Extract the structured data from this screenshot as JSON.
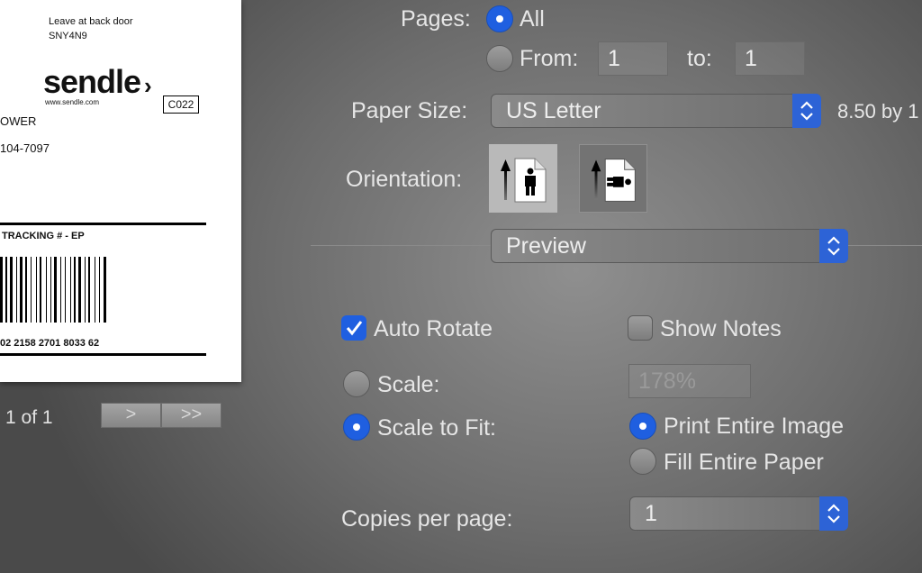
{
  "preview": {
    "delivery_note": "Leave at back door",
    "code": "SNY4N9",
    "logo_text": "sendle",
    "logo_url": "www.sendle.com",
    "box_code": "C022",
    "name_fragment": "OWER",
    "phone_fragment": "104-7097",
    "tracking_label": "TRACKING # - EP",
    "tracking_number": "02 2158 2701 8033 62",
    "page_indicator": "1 of 1",
    "next_label": ">",
    "last_label": ">>"
  },
  "pages": {
    "label": "Pages:",
    "all_label": "All",
    "from_label": "From:",
    "from_value": "1",
    "to_label": "to:",
    "to_value": "1"
  },
  "paper_size": {
    "label": "Paper Size:",
    "value": "US Letter",
    "dimensions": "8.50 by 1"
  },
  "orientation": {
    "label": "Orientation:"
  },
  "section_popup": {
    "value": "Preview"
  },
  "options": {
    "auto_rotate": "Auto Rotate",
    "show_notes": "Show Notes",
    "scale_label": "Scale:",
    "scale_value": "178%",
    "scale_to_fit": "Scale to Fit:",
    "print_entire_image": "Print Entire Image",
    "fill_entire_paper": "Fill Entire Paper",
    "copies_label": "Copies per page:",
    "copies_value": "1"
  },
  "colors": {
    "accent": "#1f5fe0"
  }
}
